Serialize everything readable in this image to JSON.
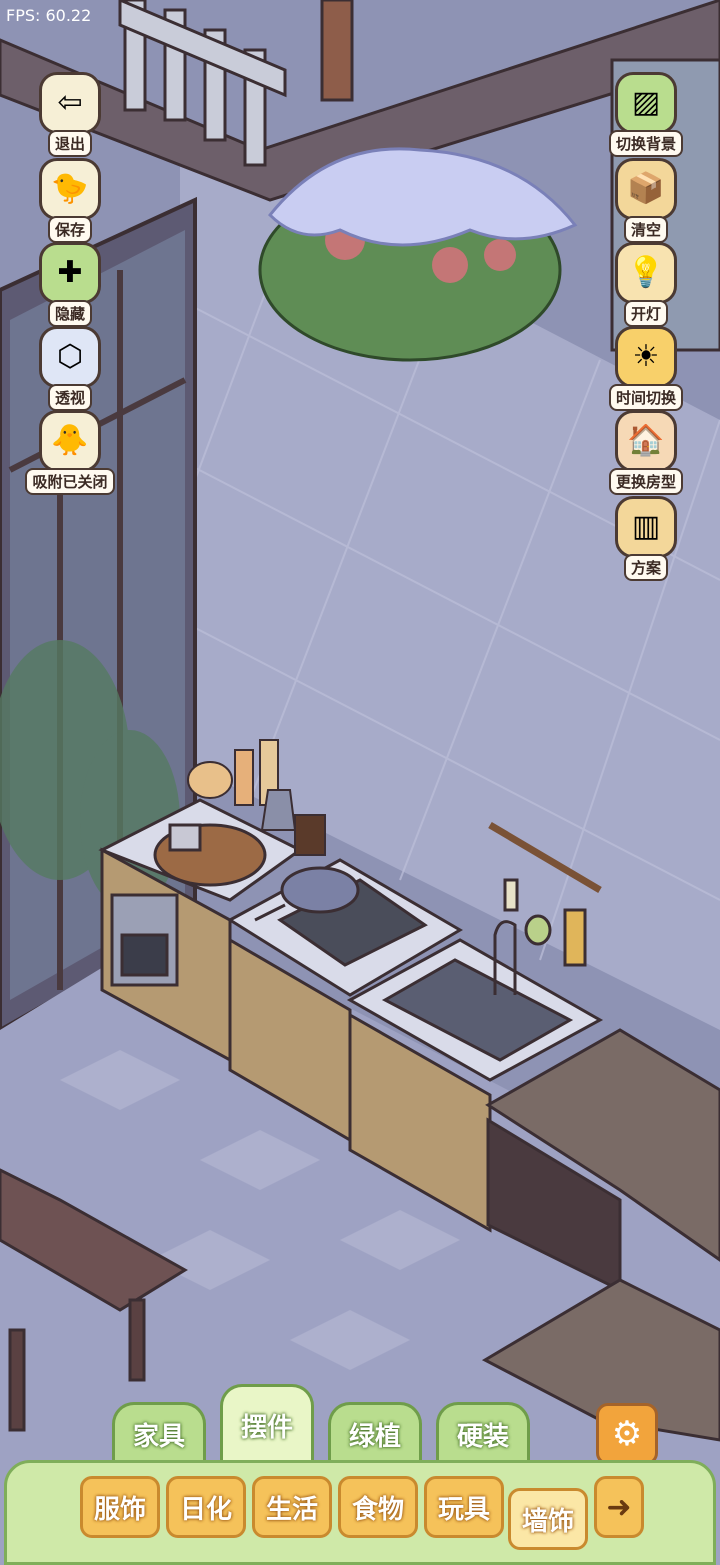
{
  "hud": {
    "fps_text": "FPS: 60.22"
  },
  "left_buttons": [
    {
      "label": "退出",
      "icon": "exit-icon",
      "glyph": "⇦"
    },
    {
      "label": "保存",
      "icon": "chick-save-icon",
      "glyph": "🐤"
    },
    {
      "label": "隐藏",
      "icon": "hide-icon",
      "glyph": "✚"
    },
    {
      "label": "透视",
      "icon": "perspective-cube-icon",
      "glyph": "⬡"
    },
    {
      "label": "吸附已关闭",
      "icon": "snap-chicks-icon",
      "glyph": "🐥"
    }
  ],
  "right_buttons": [
    {
      "label": "切换背景",
      "icon": "switch-background-icon",
      "glyph": "▨"
    },
    {
      "label": "清空",
      "icon": "clear-box-icon",
      "glyph": "📦"
    },
    {
      "label": "开灯",
      "icon": "light-icon",
      "glyph": "💡"
    },
    {
      "label": "时间切换",
      "icon": "time-switch-icon",
      "glyph": "☀"
    },
    {
      "label": "更换房型",
      "icon": "house-icon",
      "glyph": "🏠"
    },
    {
      "label": "方案",
      "icon": "plan-icon",
      "glyph": "▥"
    }
  ],
  "tabs": [
    {
      "label": "家具",
      "active": false
    },
    {
      "label": "摆件",
      "active": true
    },
    {
      "label": "绿植",
      "active": false
    },
    {
      "label": "硬装",
      "active": false
    }
  ],
  "categories": [
    {
      "label": "服饰",
      "active": false
    },
    {
      "label": "日化",
      "active": false
    },
    {
      "label": "生活",
      "active": false
    },
    {
      "label": "食物",
      "active": false
    },
    {
      "label": "玩具",
      "active": false
    },
    {
      "label": "墙饰",
      "active": true
    }
  ],
  "colors": {
    "wall": "#a7abc9",
    "floor": "#9ea2c3",
    "wood_dark": "#4a3a3f",
    "counter_top": "#d9dbe9",
    "cabinet": "#b59a72",
    "leaf": "#5f8d55",
    "snow": "#c9cdf2",
    "panel_green": "#cfe9a8",
    "button_orange": "#f5c25a"
  }
}
